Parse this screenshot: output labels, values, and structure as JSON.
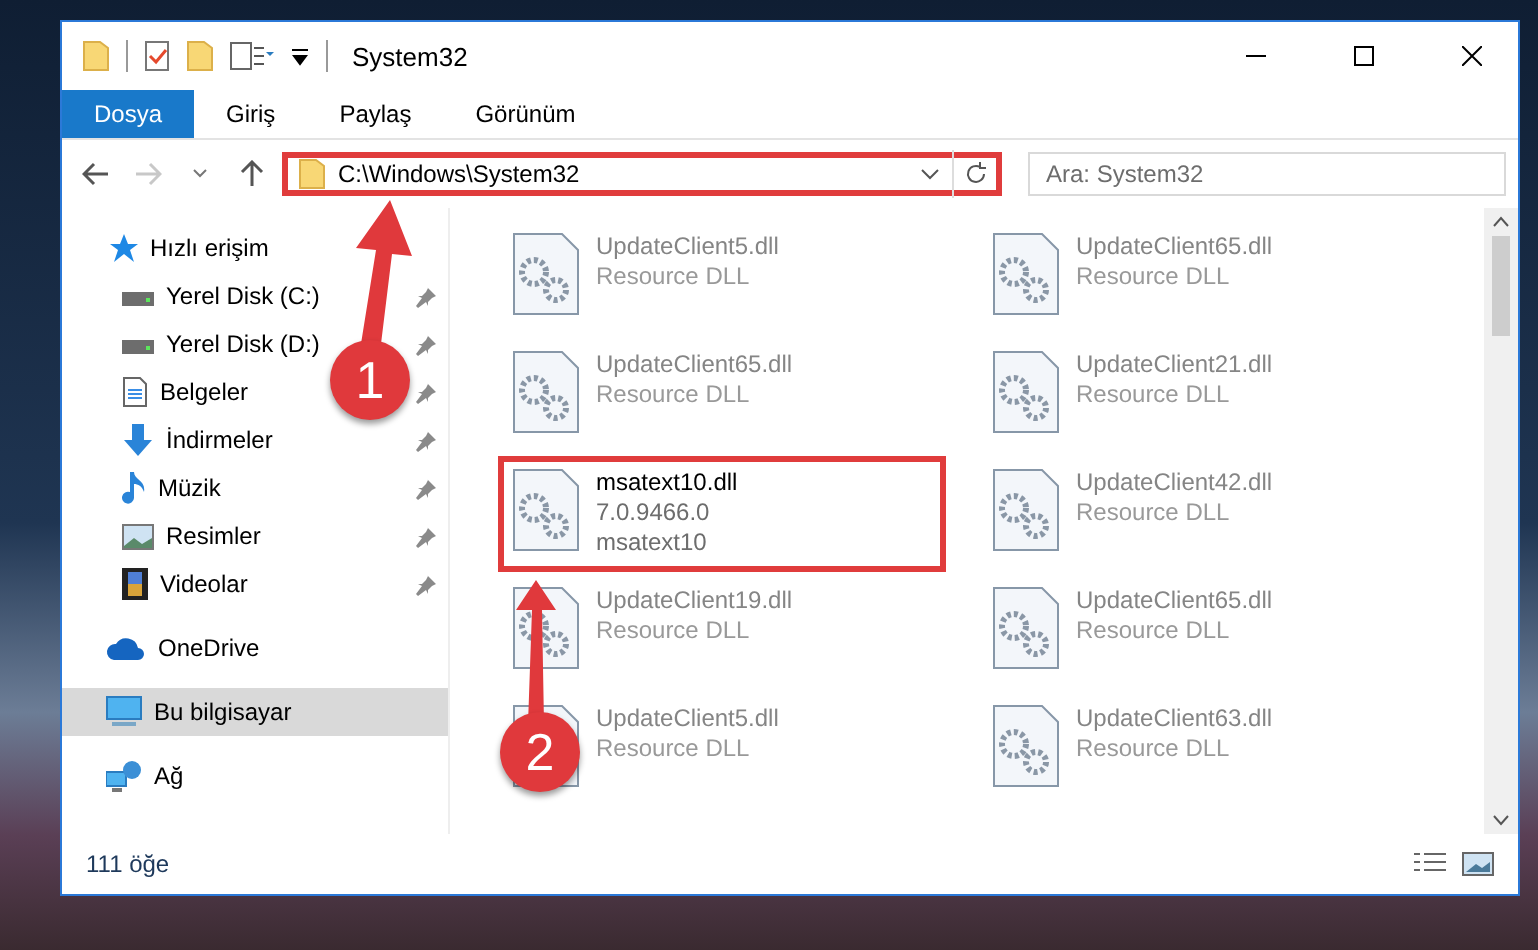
{
  "window": {
    "title": "System32"
  },
  "ribbon_tabs": [
    {
      "label": "Dosya",
      "selected": true
    },
    {
      "label": "Giriş",
      "selected": false
    },
    {
      "label": "Paylaş",
      "selected": false
    },
    {
      "label": "Görünüm",
      "selected": false
    }
  ],
  "address": {
    "path": "C:\\Windows\\System32",
    "highlighted": true
  },
  "search": {
    "placeholder": "Ara: System32"
  },
  "sidebar": {
    "items": [
      {
        "label": "Hızlı erişim",
        "kind": "star",
        "selected": false,
        "children": [
          {
            "label": "Yerel Disk (C:)",
            "kind": "drive",
            "pinned": true
          },
          {
            "label": "Yerel Disk (D:)",
            "kind": "drive",
            "pinned": true
          },
          {
            "label": "Belgeler",
            "kind": "document",
            "pinned": true
          },
          {
            "label": "İndirmeler",
            "kind": "download",
            "pinned": true
          },
          {
            "label": "Müzik",
            "kind": "music",
            "pinned": true
          },
          {
            "label": "Resimler",
            "kind": "picture",
            "pinned": true
          },
          {
            "label": "Videolar",
            "kind": "video",
            "pinned": true
          }
        ]
      },
      {
        "label": "OneDrive",
        "kind": "cloud",
        "selected": false
      },
      {
        "label": "Bu bilgisayar",
        "kind": "computer",
        "selected": true
      },
      {
        "label": "Ağ",
        "kind": "network",
        "selected": false
      }
    ]
  },
  "files": [
    {
      "name": "UpdateClient5.dll",
      "details": [
        "Resource DLL"
      ],
      "blurred": true,
      "highlighted": false
    },
    {
      "name": "UpdateClient65.dll",
      "details": [
        "Resource DLL"
      ],
      "blurred": true,
      "highlighted": false
    },
    {
      "name": "UpdateClient65.dll",
      "details": [
        "Resource DLL"
      ],
      "blurred": true,
      "highlighted": false
    },
    {
      "name": "UpdateClient21.dll",
      "details": [
        "Resource DLL"
      ],
      "blurred": true,
      "highlighted": false
    },
    {
      "name": "msatext10.dll",
      "details": [
        "7.0.9466.0",
        "msatext10"
      ],
      "blurred": false,
      "highlighted": true
    },
    {
      "name": "UpdateClient42.dll",
      "details": [
        "Resource DLL"
      ],
      "blurred": true,
      "highlighted": false
    },
    {
      "name": "UpdateClient19.dll",
      "details": [
        "Resource DLL"
      ],
      "blurred": true,
      "highlighted": false
    },
    {
      "name": "UpdateClient65.dll",
      "details": [
        "Resource DLL"
      ],
      "blurred": true,
      "highlighted": false
    },
    {
      "name": "UpdateClient5.dll",
      "details": [
        "Resource DLL"
      ],
      "blurred": true,
      "highlighted": false
    },
    {
      "name": "UpdateClient63.dll",
      "details": [
        "Resource DLL"
      ],
      "blurred": true,
      "highlighted": false
    }
  ],
  "status_bar": {
    "count": "111 öğe"
  },
  "annotations": [
    {
      "number": "1"
    },
    {
      "number": "2"
    }
  ]
}
